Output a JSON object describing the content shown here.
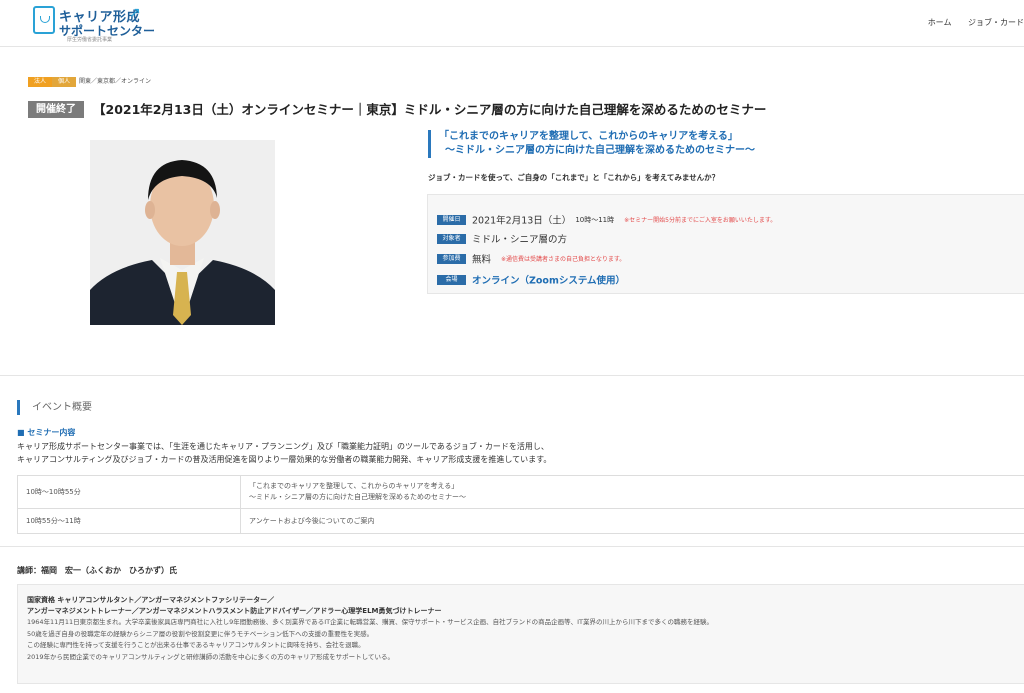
{
  "header": {
    "logo": {
      "line1": "キャリア形成",
      "line2": "サポートセンター",
      "tagline": "厚生労働省委託事業"
    },
    "nav": [
      "ホーム",
      "ジョブ・カード"
    ]
  },
  "event": {
    "tags": [
      "法人",
      "個人"
    ],
    "location": "関東／東京都／オンライン",
    "status": "開催終了",
    "title": "【2021年2月13日（土）オンラインセミナー｜東京】ミドル・シニア層の方に向けた自己理解を深めるためのセミナー",
    "quote_line1": "「これまでのキャリアを整理して、これからのキャリアを考える」",
    "quote_line2": "～ミドル・シニア層の方に向けた自己理解を深めるためのセミナー～",
    "intro": "ジョブ・カードを使って、ご自身の「これまで」と「これから」を考えてみませんか？",
    "info": {
      "date_label": "開催日",
      "date_value": "2021年2月13日（土）",
      "date_time": "10時～11時",
      "date_note": "※セミナー開始5分前までにご入室をお願いいたします。",
      "target_label": "対象者",
      "target_value": "ミドル・シニア層の方",
      "fee_label": "参加費",
      "fee_value": "無料",
      "fee_note": "※通信費は受講者さまの自己負担となります。",
      "venue_label": "会場",
      "venue_value": "オンライン（Zoomシステム使用）"
    }
  },
  "overview": {
    "section_title": "イベント概要",
    "seminar_label": "■ セミナー内容",
    "desc_line1": "キャリア形成サポートセンター事業では、「生涯を通じたキャリア・プランニング」及び「職業能力証明」のツールであるジョブ・カードを活用し、",
    "desc_line2": "キャリアコンサルティング及びジョブ・カードの普及活用促進を図りより一層効果的な労働者の職業能力開発、キャリア形成支援を推進しています。",
    "schedule": [
      {
        "time": "10時～10時55分",
        "line1": "「これまでのキャリアを整理して、これからのキャリアを考える」",
        "line2": "～ミドル・シニア層の方に向けた自己理解を深めるためのセミナー～"
      },
      {
        "time": "10時55分～11時",
        "line1": "アンケートおよび今後についてのご案内",
        "line2": ""
      }
    ]
  },
  "instructor": {
    "label": "講師：福岡　宏一（ふくおか　ひろかず）氏",
    "bio_h1": "国家資格 キャリアコンサルタント／アンガーマネジメントファシリテーター／",
    "bio_h2": "アンガーマネジメントトレーナー／アンガーマネジメントハラスメント防止アドバイザー／アドラー心理学ELM勇気づけトレーナー",
    "bio_lines": [
      "1964年11月11日東京都生まれ。大学卒業後家具店専門商社に入社し9年間勤務後、多く別業界であるIT企業に転職営業、購買、保守サポート・サービス企画、自社ブランドの商品企画等、IT業界の川上から川下まで多くの職務を経験。",
      "50歳を過ぎ自身の役職定年の経験からシニア層の役割や役割変更に伴うモチベーション低下への支援の重要性を実感。",
      "この経験に専門性を持って支援を行うことが出来る仕事であるキャリアコンサルタントに興味を持ち、会社を退職。",
      "2019年から民間企業でのキャリアコンサルティングと研修講師の活動を中心に多くの方のキャリア形成をサポートしている。"
    ]
  },
  "colors": {
    "accent_blue": "#2b6ca8",
    "link_blue": "#1f6db3",
    "tag_orange": "#f0a021",
    "note_red": "#e34b4b",
    "badge_gray": "#7b7b7b"
  }
}
